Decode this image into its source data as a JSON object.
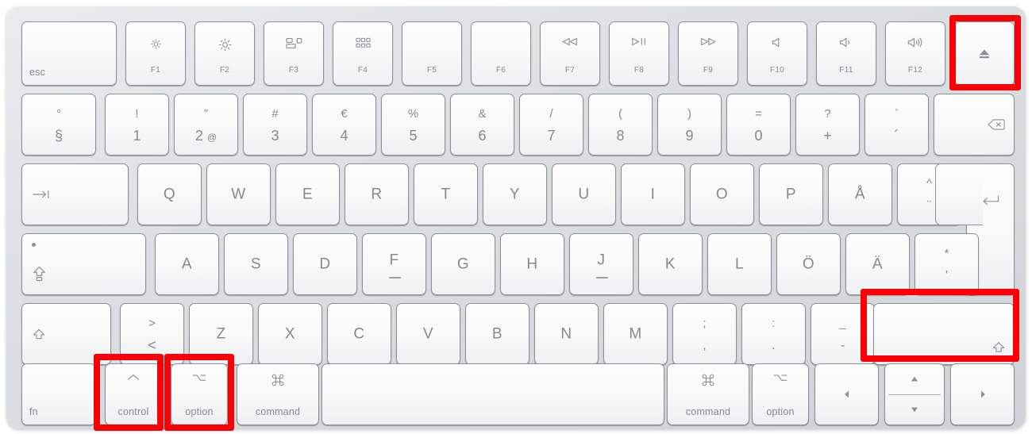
{
  "meta": {
    "device": "Apple Magic Keyboard",
    "layout": "Swedish (SE)",
    "chassis_color": "#dcdfe2",
    "keycap_color": "#fafbfb",
    "legend_color": "#8b8f93",
    "highlight_color": "#fb0007"
  },
  "highlights": [
    {
      "id": "eject-key",
      "label": "Eject"
    },
    {
      "id": "right-shift-key",
      "label": "Right Shift"
    },
    {
      "id": "control-key",
      "label": "Control"
    },
    {
      "id": "option-key",
      "label": "Option"
    }
  ],
  "rows": {
    "function_row": [
      {
        "name": "esc",
        "corner": "esc"
      },
      {
        "name": "f1",
        "icon": "brightness-down-icon",
        "fn": "F1"
      },
      {
        "name": "f2",
        "icon": "brightness-up-icon",
        "fn": "F2"
      },
      {
        "name": "f3",
        "icon": "mission-control-icon",
        "fn": "F3"
      },
      {
        "name": "f4",
        "icon": "launchpad-icon",
        "fn": "F4"
      },
      {
        "name": "f5",
        "icon": "",
        "fn": "F5"
      },
      {
        "name": "f6",
        "icon": "",
        "fn": "F6"
      },
      {
        "name": "f7",
        "icon": "rewind-icon",
        "fn": "F7"
      },
      {
        "name": "f8",
        "icon": "play-pause-icon",
        "fn": "F8"
      },
      {
        "name": "f9",
        "icon": "fast-forward-icon",
        "fn": "F9"
      },
      {
        "name": "f10",
        "icon": "volume-mute-icon",
        "fn": "F10"
      },
      {
        "name": "f11",
        "icon": "volume-down-icon",
        "fn": "F11"
      },
      {
        "name": "f12",
        "icon": "volume-up-icon",
        "fn": "F12"
      },
      {
        "name": "eject",
        "icon": "eject-icon",
        "fn": ""
      }
    ],
    "number_row": [
      {
        "name": "section",
        "upper": "°",
        "lower": "§"
      },
      {
        "name": "1",
        "upper": "!",
        "lower": "1"
      },
      {
        "name": "2",
        "upper": "”",
        "lower": "2",
        "extra": "@"
      },
      {
        "name": "3",
        "upper": "#",
        "lower": "3"
      },
      {
        "name": "4",
        "upper": "€",
        "lower": "4"
      },
      {
        "name": "5",
        "upper": "%",
        "lower": "5"
      },
      {
        "name": "6",
        "upper": "&",
        "lower": "6"
      },
      {
        "name": "7",
        "upper": "/",
        "lower": "7"
      },
      {
        "name": "8",
        "upper": "(",
        "lower": "8"
      },
      {
        "name": "9",
        "upper": ")",
        "lower": "9"
      },
      {
        "name": "0",
        "upper": "=",
        "lower": "0"
      },
      {
        "name": "plus",
        "upper": "?",
        "lower": "+"
      },
      {
        "name": "acute",
        "upper": "`",
        "lower": "´"
      },
      {
        "name": "delete",
        "icon": "delete-icon"
      }
    ],
    "top_row": [
      {
        "name": "tab",
        "icon": "tab-icon"
      },
      {
        "name": "q",
        "letter": "Q"
      },
      {
        "name": "w",
        "letter": "W"
      },
      {
        "name": "e",
        "letter": "E"
      },
      {
        "name": "r",
        "letter": "R"
      },
      {
        "name": "t",
        "letter": "T"
      },
      {
        "name": "y",
        "letter": "Y"
      },
      {
        "name": "u",
        "letter": "U"
      },
      {
        "name": "i",
        "letter": "I"
      },
      {
        "name": "o",
        "letter": "O"
      },
      {
        "name": "p",
        "letter": "P"
      },
      {
        "name": "aring",
        "letter": "Å"
      },
      {
        "name": "diaeresis",
        "upper": "^",
        "lower": "¨"
      },
      {
        "name": "return",
        "icon": "return-icon"
      }
    ],
    "home_row": [
      {
        "name": "capslock",
        "icon": "capslock-icon"
      },
      {
        "name": "a",
        "letter": "A"
      },
      {
        "name": "s",
        "letter": "S"
      },
      {
        "name": "d",
        "letter": "D"
      },
      {
        "name": "f",
        "letter": "F",
        "bump": true
      },
      {
        "name": "g",
        "letter": "G"
      },
      {
        "name": "h",
        "letter": "H"
      },
      {
        "name": "j",
        "letter": "J",
        "bump": true
      },
      {
        "name": "k",
        "letter": "K"
      },
      {
        "name": "l",
        "letter": "L"
      },
      {
        "name": "oumlaut",
        "letter": "Ö"
      },
      {
        "name": "aumlaut",
        "letter": "Ä"
      },
      {
        "name": "apostrophe",
        "upper": "*",
        "lower": "'"
      }
    ],
    "bottom_letter_row": [
      {
        "name": "left-shift",
        "icon": "shift-icon"
      },
      {
        "name": "less-greater",
        "upper": ">",
        "lower": "<"
      },
      {
        "name": "z",
        "letter": "Z"
      },
      {
        "name": "x",
        "letter": "X"
      },
      {
        "name": "c",
        "letter": "C"
      },
      {
        "name": "v",
        "letter": "V"
      },
      {
        "name": "b",
        "letter": "B"
      },
      {
        "name": "n",
        "letter": "N"
      },
      {
        "name": "m",
        "letter": "M"
      },
      {
        "name": "comma",
        "upper": ";",
        "lower": ","
      },
      {
        "name": "period",
        "upper": ":",
        "lower": "."
      },
      {
        "name": "minus",
        "upper": "_",
        "lower": "-"
      },
      {
        "name": "right-shift",
        "icon": "shift-icon"
      }
    ],
    "modifier_row": [
      {
        "name": "fn",
        "word": "fn"
      },
      {
        "name": "control",
        "icon": "control-caret-icon",
        "word": "control"
      },
      {
        "name": "option-left",
        "icon": "option-icon",
        "word": "option"
      },
      {
        "name": "command-left",
        "icon": "command-icon",
        "word": "command"
      },
      {
        "name": "space",
        "word": ""
      },
      {
        "name": "command-right",
        "icon": "command-icon",
        "word": "command"
      },
      {
        "name": "option-right",
        "icon": "option-icon",
        "word": "option"
      },
      {
        "name": "arrow-left",
        "icon": "arrow-left-icon"
      },
      {
        "name": "arrow-up-down",
        "icon_top": "arrow-up-icon",
        "icon_bottom": "arrow-down-icon"
      },
      {
        "name": "arrow-right",
        "icon": "arrow-right-icon"
      }
    ]
  }
}
